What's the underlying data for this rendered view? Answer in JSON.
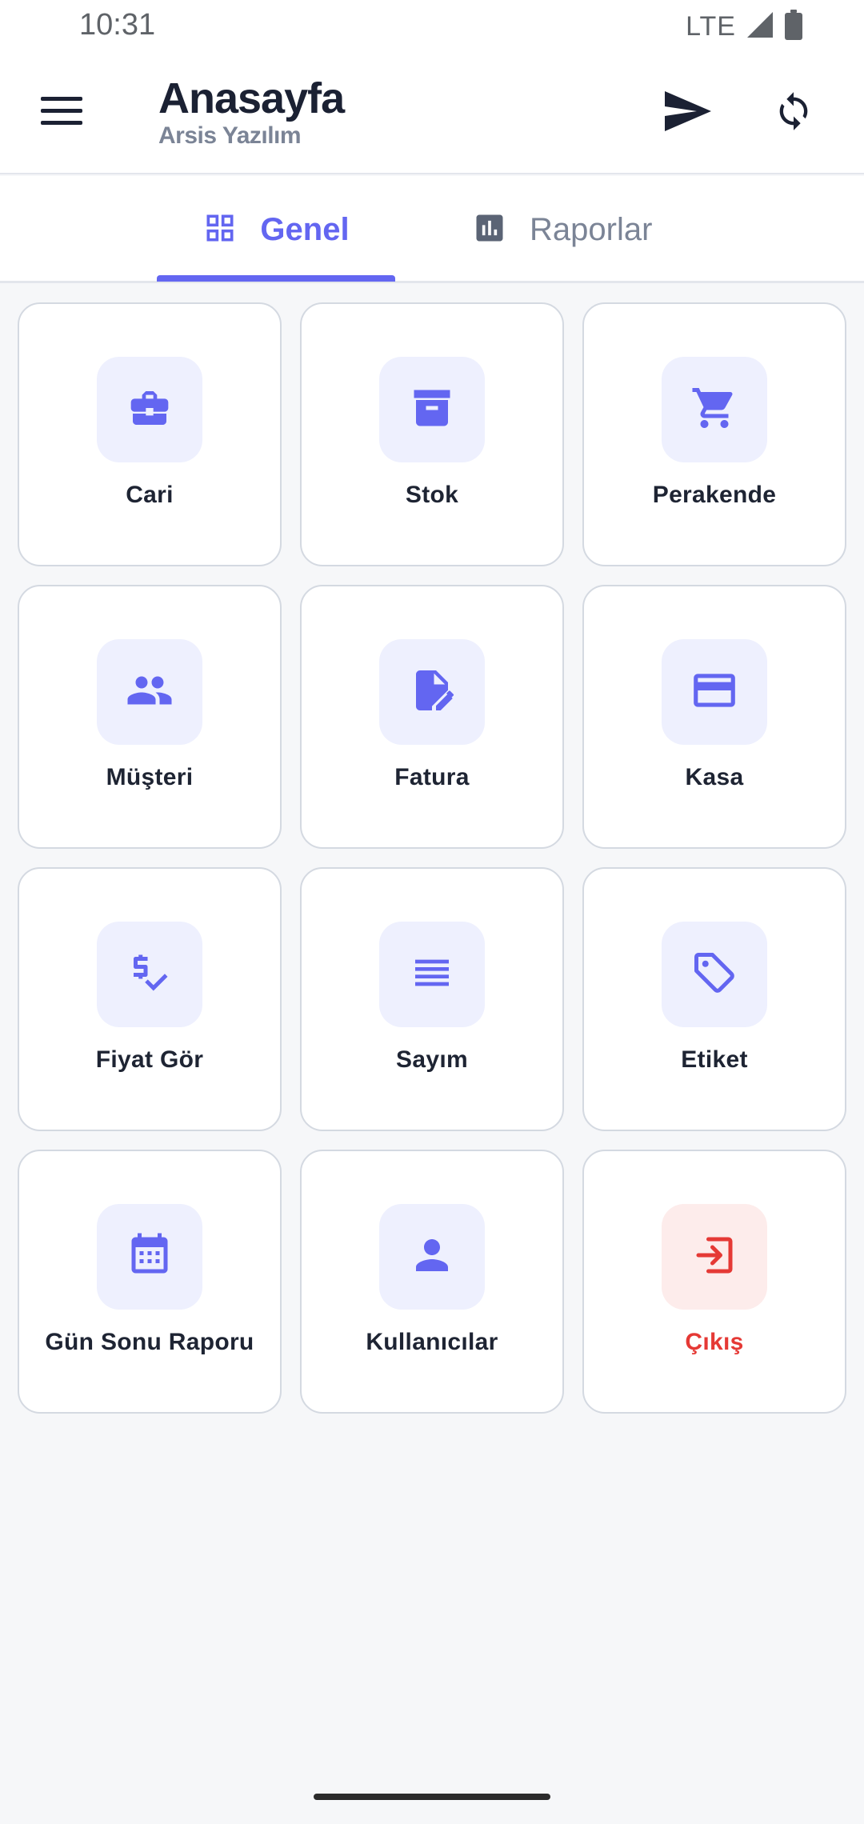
{
  "status_bar": {
    "time": "10:31",
    "network": "LTE"
  },
  "app_bar": {
    "title": "Anasayfa",
    "subtitle": "Arsis Yazılım",
    "menu_icon": "menu-icon",
    "send_icon": "send-icon",
    "sync_icon": "sync-icon"
  },
  "tabs": [
    {
      "label": "Genel",
      "icon": "grid-icon",
      "selected": true
    },
    {
      "label": "Raporlar",
      "icon": "bar-chart-icon",
      "selected": false
    }
  ],
  "colors": {
    "accent": "#6366f1",
    "accent_soft": "#eef0fe",
    "danger": "#e53935",
    "danger_soft": "#fdeceb"
  },
  "tiles": [
    {
      "label": "Cari",
      "icon": "briefcase-icon"
    },
    {
      "label": "Stok",
      "icon": "archive-box-icon"
    },
    {
      "label": "Perakende",
      "icon": "shopping-cart-icon"
    },
    {
      "label": "Müşteri",
      "icon": "people-icon"
    },
    {
      "label": "Fatura",
      "icon": "document-edit-icon"
    },
    {
      "label": "Kasa",
      "icon": "credit-card-icon"
    },
    {
      "label": "Fiyat Gör",
      "icon": "price-check-icon"
    },
    {
      "label": "Sayım",
      "icon": "list-icon"
    },
    {
      "label": "Etiket",
      "icon": "tag-icon"
    },
    {
      "label": "Gün Sonu Raporu",
      "icon": "calendar-icon"
    },
    {
      "label": "Kullanıcılar",
      "icon": "person-icon"
    },
    {
      "label": "Çıkış",
      "icon": "logout-icon",
      "danger": true
    }
  ]
}
